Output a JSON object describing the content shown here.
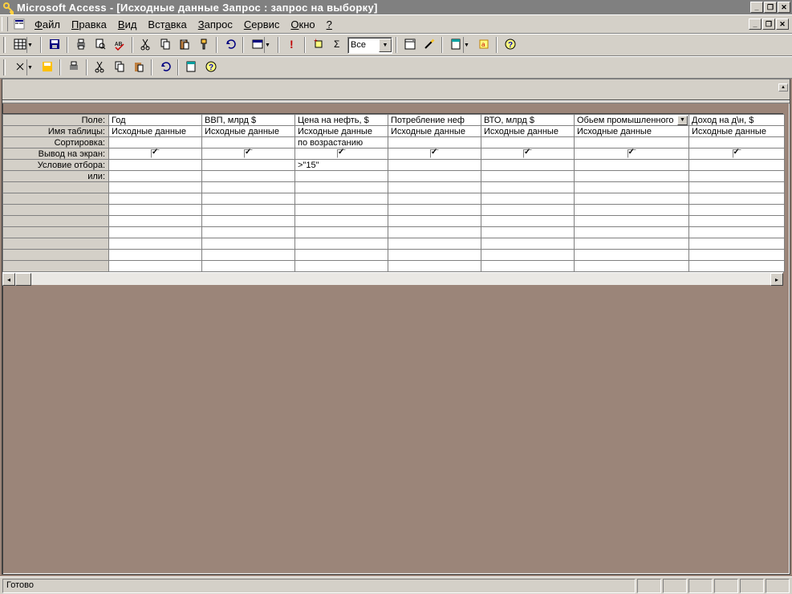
{
  "title": "Microsoft Access - [Исходные данные Запрос : запрос на выборку]",
  "menu": {
    "file": "Файл",
    "edit": "Правка",
    "view": "Вид",
    "insert": "Вставка",
    "query": "Запрос",
    "tools": "Сервис",
    "window": "Окно",
    "help": "?"
  },
  "toolbar": {
    "top_records_value": "Все"
  },
  "grid": {
    "row_labels": {
      "field": "Поле:",
      "table": "Имя таблицы:",
      "sort": "Сортировка:",
      "show": "Вывод на экран:",
      "criteria": "Условие отбора:",
      "or": "или:"
    },
    "columns": [
      {
        "field": "Год",
        "table": "Исходные данные",
        "sort": "",
        "show": true,
        "criteria": "",
        "active": false
      },
      {
        "field": "ВВП, млрд $",
        "table": "Исходные данные",
        "sort": "",
        "show": true,
        "criteria": "",
        "active": false
      },
      {
        "field": "Цена на нефть, $",
        "table": "Исходные данные",
        "sort": "по возрастанию",
        "show": true,
        "criteria": ">\"15\"",
        "active": false
      },
      {
        "field": "Потребление неф",
        "table": "Исходные данные",
        "sort": "",
        "show": true,
        "criteria": "",
        "active": false
      },
      {
        "field": "ВТО, млрд $",
        "table": "Исходные данные",
        "sort": "",
        "show": true,
        "criteria": "",
        "active": false
      },
      {
        "field": "Обьем промышленного",
        "table": "Исходные данные",
        "sort": "",
        "show": true,
        "criteria": "",
        "active": true
      },
      {
        "field": "Доход на д\\н, $",
        "table": "Исходные данные",
        "sort": "",
        "show": true,
        "criteria": "",
        "active": false
      }
    ]
  },
  "status": "Готово"
}
